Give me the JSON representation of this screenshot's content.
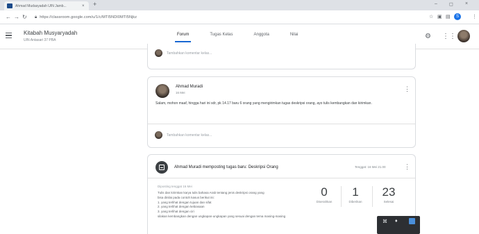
{
  "browser": {
    "tab_title": "Ahmad Mudasyadah UIN Jamb...",
    "tab_close": "×",
    "new_tab": "+",
    "url": "https://classroom.google.com/u/1/c/MTI5NDI0MTI5Njkz",
    "window_minimize": "–",
    "window_maximize": "◻",
    "window_close": "×",
    "profile_initial": "S"
  },
  "appbar": {
    "class_name": "Kitabah Musyaryadah",
    "class_sub": "UIN Antasari 37 PBA",
    "tabs": [
      {
        "label": "Forum",
        "active": true
      },
      {
        "label": "Tugas Kelas",
        "active": false
      },
      {
        "label": "Anggota",
        "active": false
      },
      {
        "label": "Nilai",
        "active": false
      }
    ]
  },
  "top_card": {
    "comment_placeholder": "Tambahkan komentar kelas..."
  },
  "post": {
    "author": "Ahmad Muradi",
    "date": "16 Mei",
    "body": "Salam, mohon maaf, hingga hari ini sdr, pk 14.17 baru 6 orang yang mengirimkan tugas deskripsi orang, ayo tulis kembangkan dan kirimkan.",
    "comment_placeholder": "Tambahkan komentar kelas..."
  },
  "assignment": {
    "title": "Ahmad Muradi memposting tugas baru: Deskripsi Orang",
    "due": "Tenggat: 16 Mei 21.00",
    "meta": "Diposting tenggat 16 Mei",
    "description": [
      "Tulis dan kirimkan karya tulis bahasa Arab tentang jenis deskripsi orang yang",
      "bisa dinilai pada contoh kasus berikut ini:",
      "1. yang terlihat dengan tujuan dan sifat",
      "2. yang terlihat dengan kebiasaan",
      "3. yang terlihat dengan ciri",
      "silakan kembangkan dengan ungkapan-ungkapan yang sesuai dengan tema masing-masing"
    ],
    "stats": [
      {
        "num": "0",
        "label": "Diserahkan"
      },
      {
        "num": "1",
        "label": "Diberikan"
      },
      {
        "num": "23",
        "label": "Selesai"
      }
    ]
  }
}
